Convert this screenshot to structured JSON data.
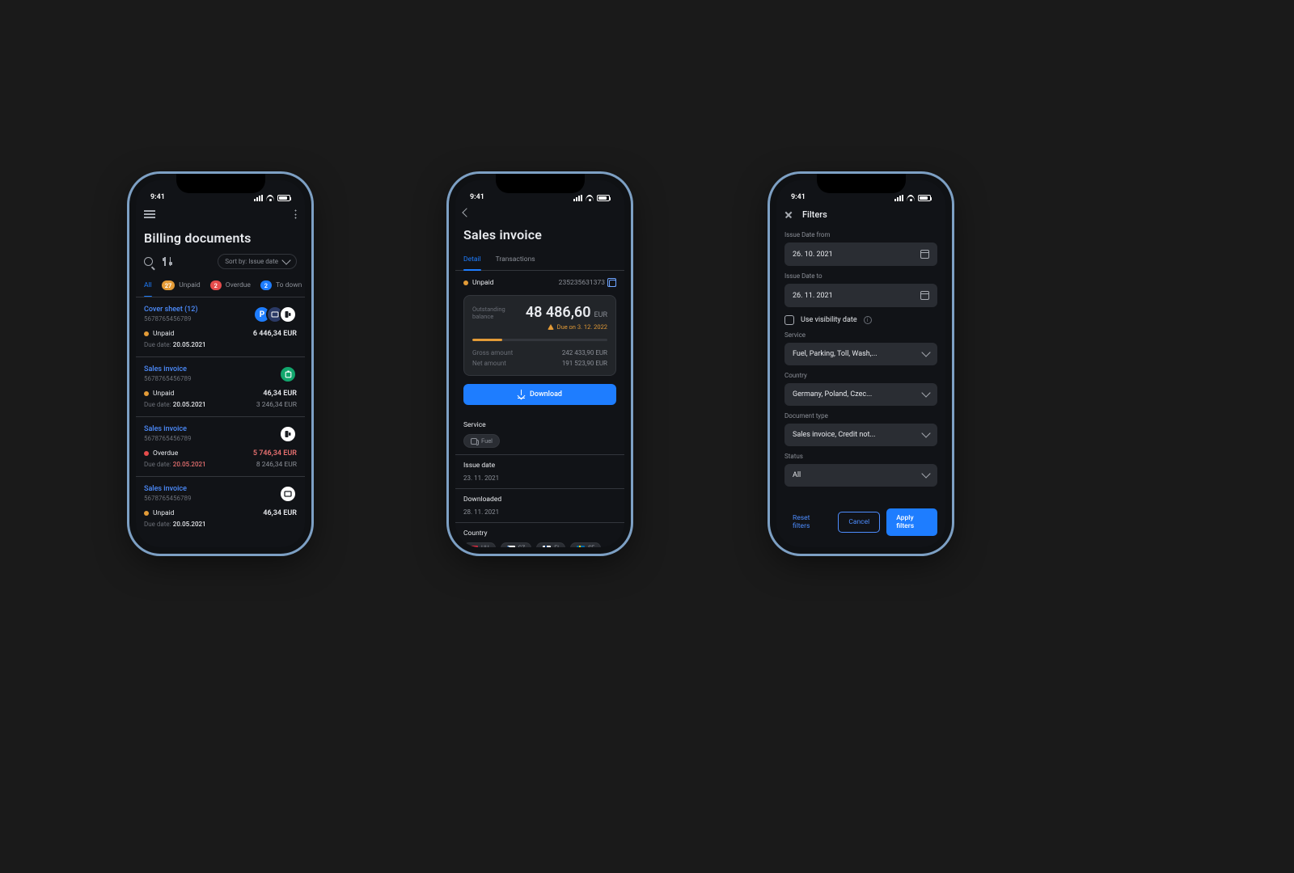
{
  "status_time": "9:41",
  "p1": {
    "title": "Billing documents",
    "sort_label": "Sort by: Issue date",
    "tabs": [
      {
        "label": "All"
      },
      {
        "badge": "27",
        "label": "Unpaid"
      },
      {
        "badge": "2",
        "label": "Overdue"
      },
      {
        "badge": "2",
        "label": "To down"
      }
    ],
    "rows": [
      {
        "title": "Cover sheet (12)",
        "sub": "5678765456789",
        "status": "Unpaid",
        "dot": "orange",
        "amt": "6 446,34 EUR",
        "amt_red": false,
        "due_lbl": "Due date:",
        "due": "20.05.2021",
        "due_red": false,
        "amt2": "",
        "icons": [
          "P",
          "toll",
          "pump"
        ]
      },
      {
        "title": "Sales invoice",
        "sub": "5678765456789",
        "status": "Unpaid",
        "dot": "orange",
        "amt": "46,34 EUR",
        "amt_red": false,
        "due_lbl": "Due date:",
        "due": "20.05.2021",
        "due_red": false,
        "amt2": "3 246,34 EUR",
        "icons": [
          "green"
        ]
      },
      {
        "title": "Sales invoice",
        "sub": "5678765456789",
        "status": "Overdue",
        "dot": "red",
        "amt": "5 746,34 EUR",
        "amt_red": true,
        "due_lbl": "Due date:",
        "due": "20.05.2021",
        "due_red": true,
        "amt2": "8 246,34 EUR",
        "icons": [
          "pump-w"
        ]
      },
      {
        "title": "Sales invoice",
        "sub": "5678765456789",
        "status": "Unpaid",
        "dot": "orange",
        "amt": "46,34 EUR",
        "amt_red": false,
        "due_lbl": "Due date:",
        "due": "20.05.2021",
        "due_red": false,
        "amt2": "",
        "icons": [
          "toll-w"
        ]
      }
    ]
  },
  "p2": {
    "title": "Sales invoice",
    "tabs": [
      {
        "label": "Detail"
      },
      {
        "label": "Transactions"
      }
    ],
    "status": "Unpaid",
    "invoice_no": "235235631373",
    "balance_label": "Outstanding\nbalance",
    "balance_amount": "48 486,60",
    "balance_currency": "EUR",
    "due_warn": "Due on 3. 12. 2022",
    "gross_label": "Gross amount",
    "gross_value": "242 433,90 EUR",
    "net_label": "Net amount",
    "net_value": "191 523,90 EUR",
    "download_label": "Download",
    "service_label": "Service",
    "service_chip": "Fuel",
    "issue_label": "Issue date",
    "issue_value": "23. 11. 2021",
    "downloaded_label": "Downloaded",
    "downloaded_value": "28. 11. 2021",
    "country_label": "Country",
    "countries": [
      "HU",
      "CZ",
      "FI",
      "SE"
    ]
  },
  "p3": {
    "title": "Filters",
    "from_label": "Issue Date from",
    "from_value": "26. 10. 2021",
    "to_label": "Issue Date to",
    "to_value": "26. 11. 2021",
    "visibility_label": "Use visibility date",
    "service_label": "Service",
    "service_value": "Fuel, Parking, Toll, Wash,...",
    "country_label": "Country",
    "country_value": "Germany, Poland, Czec...",
    "doctype_label": "Document type",
    "doctype_value": "Sales invoice, Credit not...",
    "status_label": "Status",
    "status_value": "All",
    "reset": "Reset filters",
    "cancel": "Cancel",
    "apply": "Apply filters"
  }
}
